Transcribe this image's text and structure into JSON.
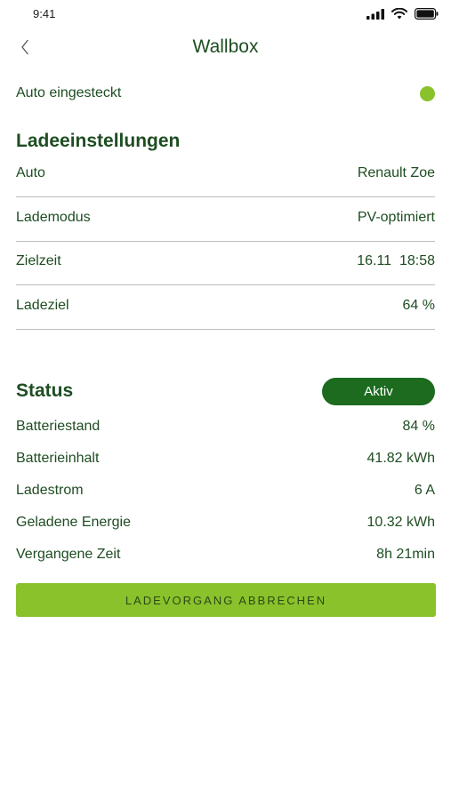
{
  "status_bar": {
    "time": "9:41"
  },
  "nav": {
    "title": "Wallbox"
  },
  "plug": {
    "label": "Auto eingesteckt",
    "indicator_color": "#8ac22c"
  },
  "settings": {
    "title": "Ladeeinstellungen",
    "rows": [
      {
        "label": "Auto",
        "value": "Renault Zoe"
      },
      {
        "label": "Lademodus",
        "value": "PV-optimiert"
      },
      {
        "label": "Zielzeit",
        "value": "16.11  18:58"
      },
      {
        "label": "Ladeziel",
        "value": "64 %"
      }
    ]
  },
  "status": {
    "title": "Status",
    "badge": "Aktiv",
    "badge_color": "#1c6b1f",
    "rows": [
      {
        "label": "Batteriestand",
        "value": "84 %"
      },
      {
        "label": "Batterieinhalt",
        "value": "41.82 kWh"
      },
      {
        "label": "Ladestrom",
        "value": "6 A"
      },
      {
        "label": "Geladene Energie",
        "value": "10.32 kWh"
      },
      {
        "label": "Vergangene Zeit",
        "value": "8h 21min"
      }
    ]
  },
  "actions": {
    "cancel_label": "LADEVORGANG ABBRECHEN",
    "accent_color": "#8ac22c"
  }
}
